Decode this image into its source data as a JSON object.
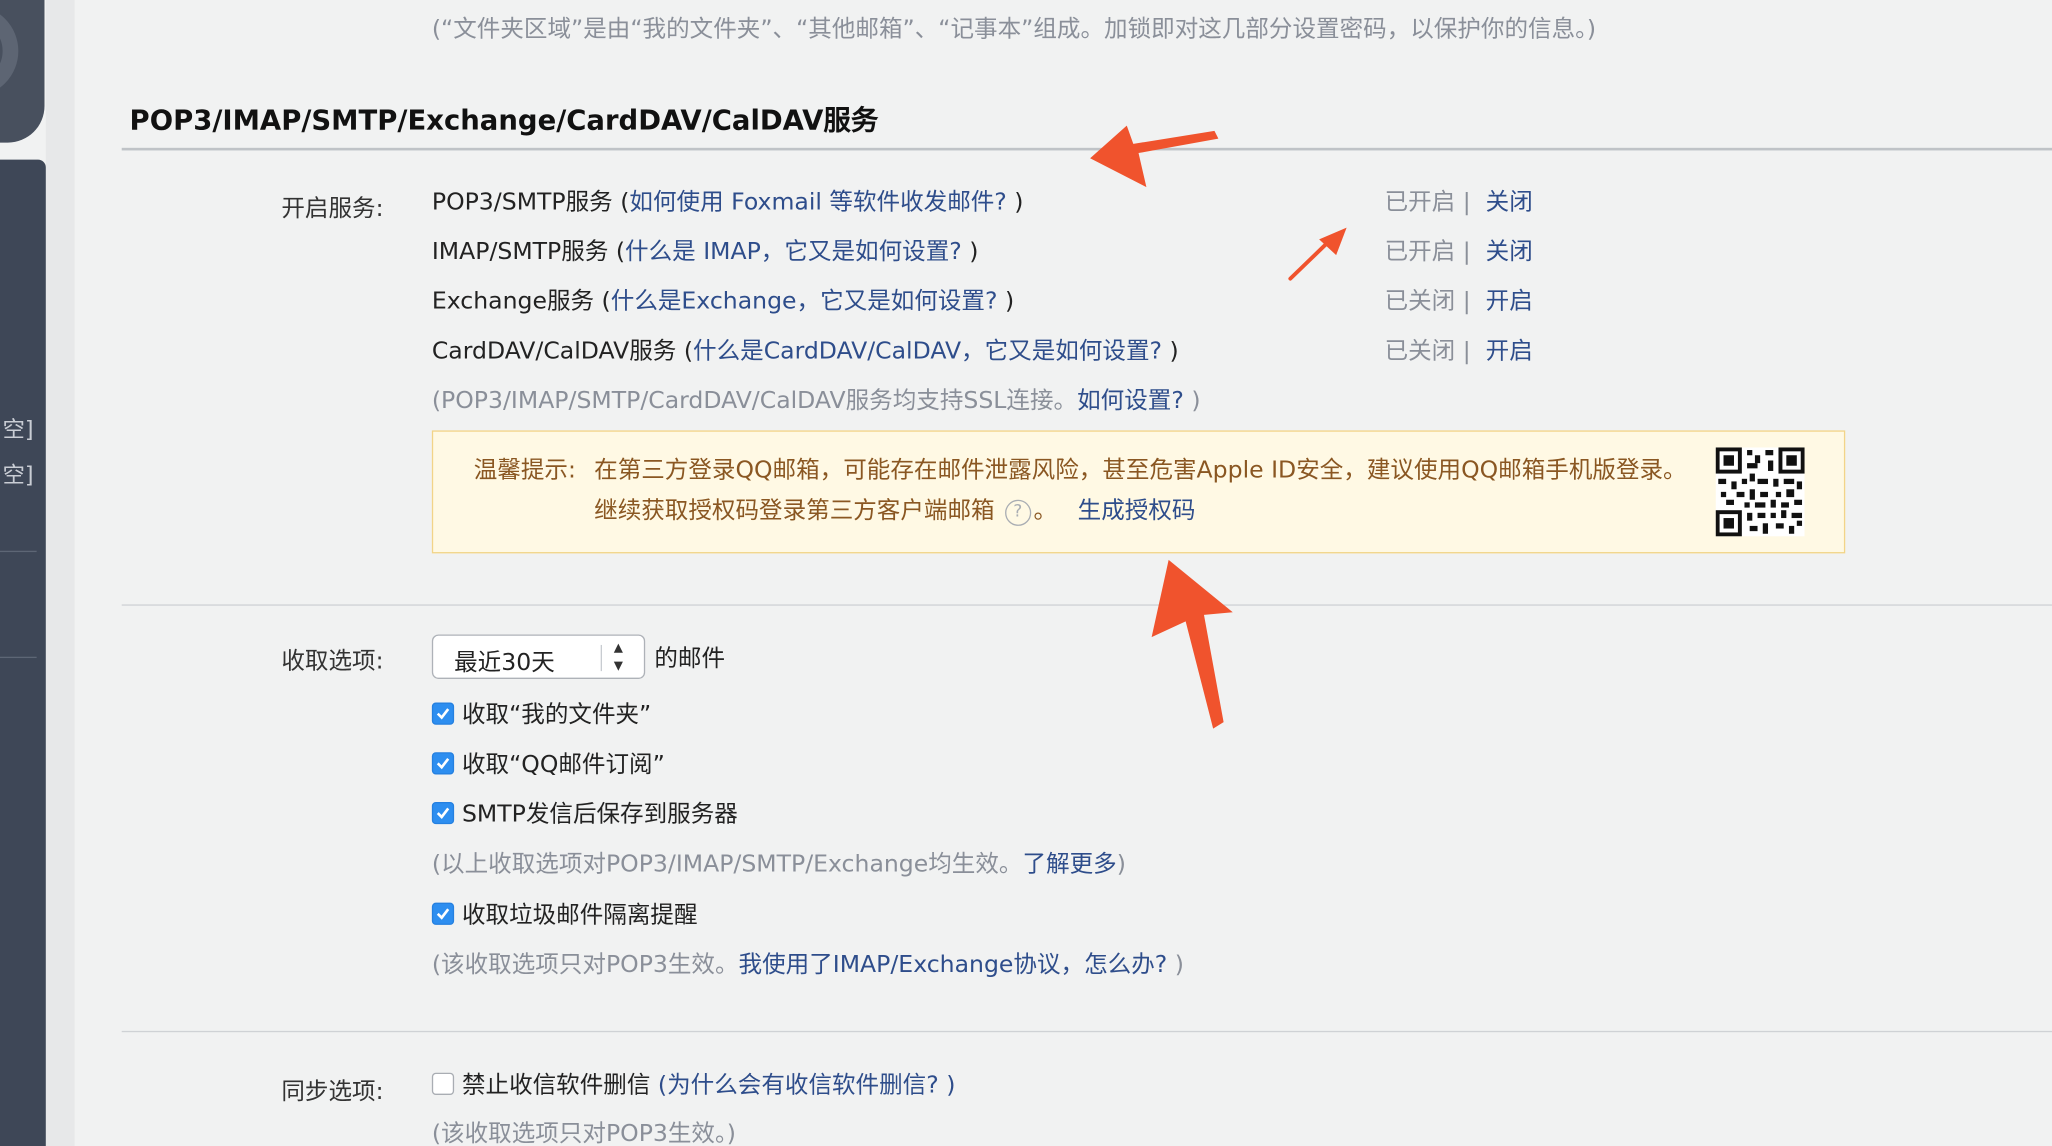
{
  "top_note": "(“文件夹区域”是由“我的文件夹”、“其他邮箱”、“记事本”组成。加锁即对这几部分设置密码，以保护你的信息。)",
  "section_title": "POP3/IMAP/SMTP/Exchange/CardDAV/CalDAV服务",
  "sidebar": {
    "items": [
      "空]",
      "空]"
    ]
  },
  "services": {
    "label": "开启服务:",
    "rows": [
      {
        "name": "POP3/SMTP服务 (",
        "help": "如何使用 Foxmail 等软件收发邮件?",
        "close": " )",
        "status": "已开启 |",
        "action": "关闭"
      },
      {
        "name": "IMAP/SMTP服务 (",
        "help": "什么是 IMAP，它又是如何设置?",
        "close": " )",
        "status": "已开启 |",
        "action": "关闭"
      },
      {
        "name": "Exchange服务 (",
        "help": "什么是Exchange，它又是如何设置?",
        "close": " )",
        "status": "已关闭 |",
        "action": "开启"
      },
      {
        "name": "CardDAV/CalDAV服务 (",
        "help": "什么是CardDAV/CalDAV，它又是如何设置?",
        "close": " )",
        "status": "已关闭 |",
        "action": "开启"
      }
    ],
    "ssl_note_prefix": "(POP3/IMAP/SMTP/CardDAV/CalDAV服务均支持SSL连接。",
    "ssl_note_link": "如何设置?",
    "ssl_note_suffix": " )"
  },
  "warning": {
    "label": "温馨提示:",
    "line1": "在第三方登录QQ邮箱，可能存在邮件泄露风险，甚至危害Apple ID安全，建议使用QQ邮箱手机版登录。",
    "line2": "继续获取授权码登录第三方客户端邮箱",
    "line2_end": "。",
    "help_icon_text": "?",
    "link": "生成授权码"
  },
  "receive": {
    "label": "收取选项:",
    "select_value": "最近30天",
    "select_suffix": "的邮件",
    "options": [
      {
        "label": "收取“我的文件夹”",
        "checked": true
      },
      {
        "label": "收取“QQ邮件订阅”",
        "checked": true
      },
      {
        "label": "SMTP发信后保存到服务器",
        "checked": true
      }
    ],
    "note_prefix": "(以上收取选项对POP3/IMAP/SMTP/Exchange均生效。",
    "note_link": "了解更多",
    "note_suffix": ")",
    "spam_option": {
      "label": "收取垃圾邮件隔离提醒",
      "checked": true
    },
    "spam_note_prefix": "(该收取选项只对POP3生效。",
    "spam_note_link": "我使用了IMAP/Exchange协议，怎么办?",
    "spam_note_suffix": " )"
  },
  "sync": {
    "label": "同步选项:",
    "option": {
      "label": "禁止收信软件删信",
      "checked": false
    },
    "help": "(为什么会有收信软件删信?",
    "help_close": " )",
    "note": "(该收取选项只对POP3生效。)"
  },
  "colors": {
    "link": "#2e4d8b",
    "annotation_arrow": "#f0532d",
    "checkbox": "#2d8ef0",
    "warning_text": "#8a5722"
  },
  "icons": [
    "app-logo-icon",
    "help-circle-icon",
    "qr-code-icon",
    "checkbox-checked-icon",
    "select-arrows-icon",
    "annotation-arrow-icon"
  ]
}
